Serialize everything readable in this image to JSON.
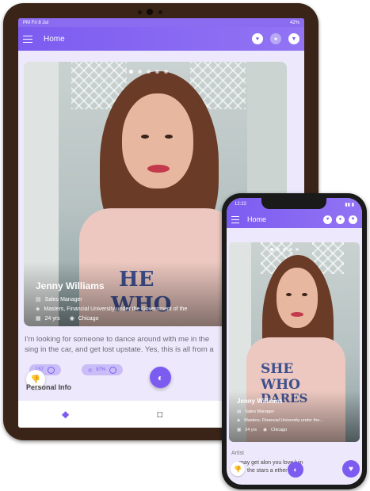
{
  "tablet": {
    "status": {
      "time": "PM  Fri 8 Jul",
      "battery": "42%"
    },
    "appbar": {
      "title": "Home"
    },
    "profile": {
      "name": "Jenny Williams",
      "job": "Sales Manager",
      "education": "Masters, Financial University under the Government of the",
      "age": "24 yrs",
      "city": "Chicago"
    },
    "bio": [
      "I'm looking for someone to dance around with me in the",
      "sing in the car, and get lost upstate. Yes, this is all from a"
    ],
    "chips": [
      "157",
      "87%"
    ],
    "section": "Personal Info"
  },
  "phone": {
    "status": {
      "time": "12:22"
    },
    "appbar": {
      "title": "Home"
    },
    "profile": {
      "name": "Jenny Williams",
      "job": "Sales Manager",
      "education": "Masters, Financial University under the...",
      "age": "24 yrs",
      "city": "Chicago"
    },
    "section": "Artist",
    "bio": [
      "may get alon   you love lyin",
      "the stars a    ether"
    ]
  },
  "colors": {
    "accent": "#7c5cf0",
    "bezel_tablet": "#3a2418",
    "bezel_phone": "#1a1a1a"
  },
  "icons": [
    "menu-icon",
    "heart-icon",
    "chat-icon",
    "filter-icon",
    "briefcase-icon",
    "graduation-icon",
    "calendar-icon",
    "location-icon",
    "thumbs-down-icon",
    "like-icon",
    "diamond-icon",
    "message-icon"
  ]
}
